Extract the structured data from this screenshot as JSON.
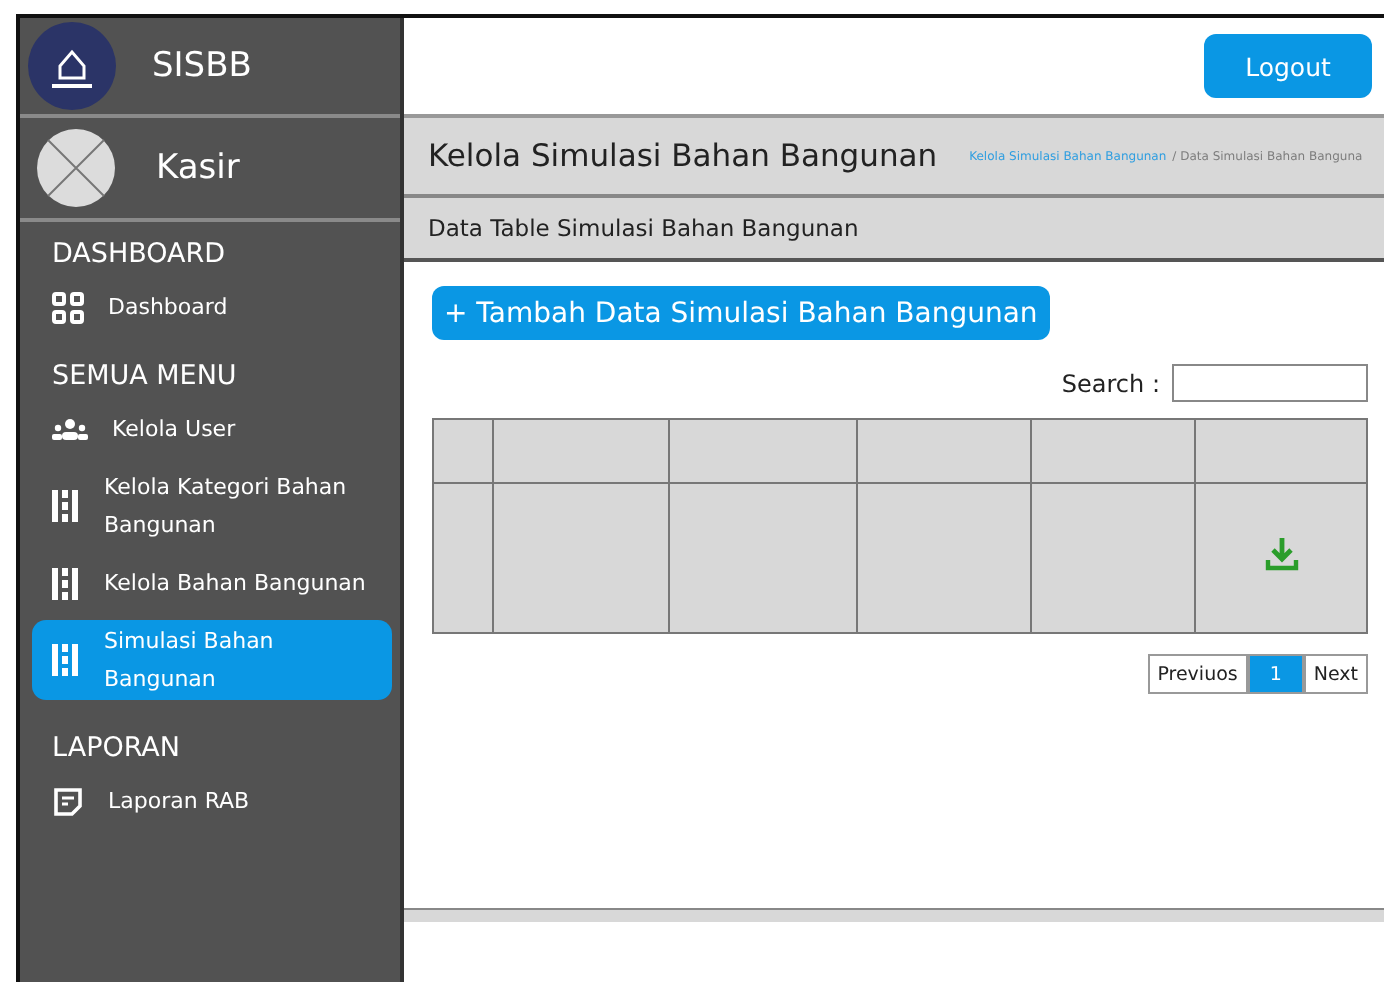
{
  "sidebar": {
    "brand": "SISBB",
    "user": "Kasir",
    "sections": [
      {
        "title": "DASHBOARD",
        "items": [
          {
            "label": "Dashboard",
            "selected": false
          }
        ]
      },
      {
        "title": "SEMUA MENU",
        "items": [
          {
            "label": "Kelola User",
            "selected": false
          },
          {
            "label": "Kelola Kategori Bahan Bangunan",
            "selected": false
          },
          {
            "label": "Kelola Bahan Bangunan",
            "selected": false
          },
          {
            "label": "Simulasi Bahan Bangunan",
            "selected": true
          }
        ]
      },
      {
        "title": "LAPORAN",
        "items": [
          {
            "label": "Laporan RAB",
            "selected": false
          }
        ]
      }
    ]
  },
  "header": {
    "logout": "Logout"
  },
  "page_title": "Kelola Simulasi Bahan Bangunan",
  "breadcrumb": [
    "Kelola Simulasi Bahan Bangunan",
    "/ Data Simulasi Bahan Banguna"
  ],
  "card_title": "Data Table Simulasi Bahan Bangunan",
  "add_button": "+ Tambah Data Simulasi Bahan Bangunan",
  "search": {
    "label": "Search :"
  },
  "table": {
    "rows": [
      {
        "has_download": true
      }
    ]
  },
  "pagination": {
    "previous": "Previuos",
    "pages": [
      {
        "label": "1",
        "selected": true
      }
    ],
    "next": "Next"
  }
}
